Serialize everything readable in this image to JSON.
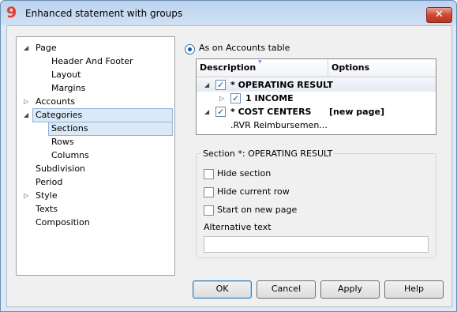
{
  "window": {
    "title": "Enhanced statement with groups",
    "app_icon_glyph": "9",
    "close_glyph": "✕"
  },
  "tree": {
    "items": [
      {
        "label": "Page",
        "expander": "◢",
        "level": 0
      },
      {
        "label": "Header And Footer",
        "expander": "",
        "level": 1
      },
      {
        "label": "Layout",
        "expander": "",
        "level": 1
      },
      {
        "label": "Margins",
        "expander": "",
        "level": 1
      },
      {
        "label": "Accounts",
        "expander": "▷",
        "level": 0
      },
      {
        "label": "Categories",
        "expander": "◢",
        "level": 0
      },
      {
        "label": "Sections",
        "expander": "",
        "level": 1
      },
      {
        "label": "Rows",
        "expander": "",
        "level": 1
      },
      {
        "label": "Columns",
        "expander": "",
        "level": 1
      },
      {
        "label": "Subdivision",
        "expander": "",
        "level": 0
      },
      {
        "label": "Period",
        "expander": "",
        "level": 0
      },
      {
        "label": "Style",
        "expander": "▷",
        "level": 0
      },
      {
        "label": "Texts",
        "expander": "",
        "level": 0
      },
      {
        "label": "Composition",
        "expander": "",
        "level": 0
      }
    ]
  },
  "layout_option": {
    "label": "As on Accounts table",
    "selected": true
  },
  "sections_table": {
    "columns": [
      "Description",
      "Options"
    ],
    "rows": [
      {
        "expander": "◢",
        "checked": true,
        "description": "* OPERATING RESULT",
        "options": ""
      },
      {
        "expander": "▷",
        "checked": true,
        "description": "1 INCOME",
        "options": ""
      },
      {
        "expander": "◢",
        "checked": true,
        "description": "* COST CENTERS",
        "options": "[new page]"
      },
      {
        "expander": "",
        "checked": false,
        "description": ".RVR Reimbursemen...",
        "options": ""
      }
    ]
  },
  "section_panel": {
    "title": "Section *: OPERATING RESULT",
    "options": [
      {
        "label": "Hide section",
        "checked": false
      },
      {
        "label": "Hide current row",
        "checked": false
      },
      {
        "label": "Start on new page",
        "checked": false
      }
    ],
    "alt_text_label": "Alternative text",
    "alt_text_value": ""
  },
  "buttons": {
    "ok": "OK",
    "cancel": "Cancel",
    "apply": "Apply",
    "help": "Help"
  }
}
